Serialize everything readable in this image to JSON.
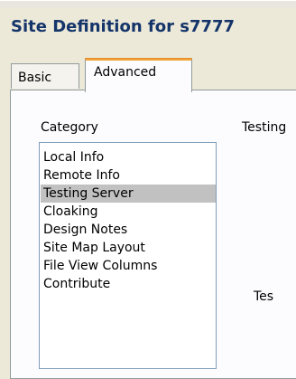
{
  "window": {
    "title": "Site Definition for s7777"
  },
  "tabs": [
    {
      "label": "Basic"
    },
    {
      "label": "Advanced"
    }
  ],
  "advanced": {
    "category_label": "Category",
    "categories": [
      {
        "label": "Local Info"
      },
      {
        "label": "Remote Info"
      },
      {
        "label": "Testing Server"
      },
      {
        "label": "Cloaking"
      },
      {
        "label": "Design Notes"
      },
      {
        "label": "Site Map Layout"
      },
      {
        "label": "File View Columns"
      },
      {
        "label": "Contribute"
      }
    ],
    "selected_category": "Testing Server",
    "right_heading": "Testing",
    "right_field_fragment": "Tes"
  }
}
